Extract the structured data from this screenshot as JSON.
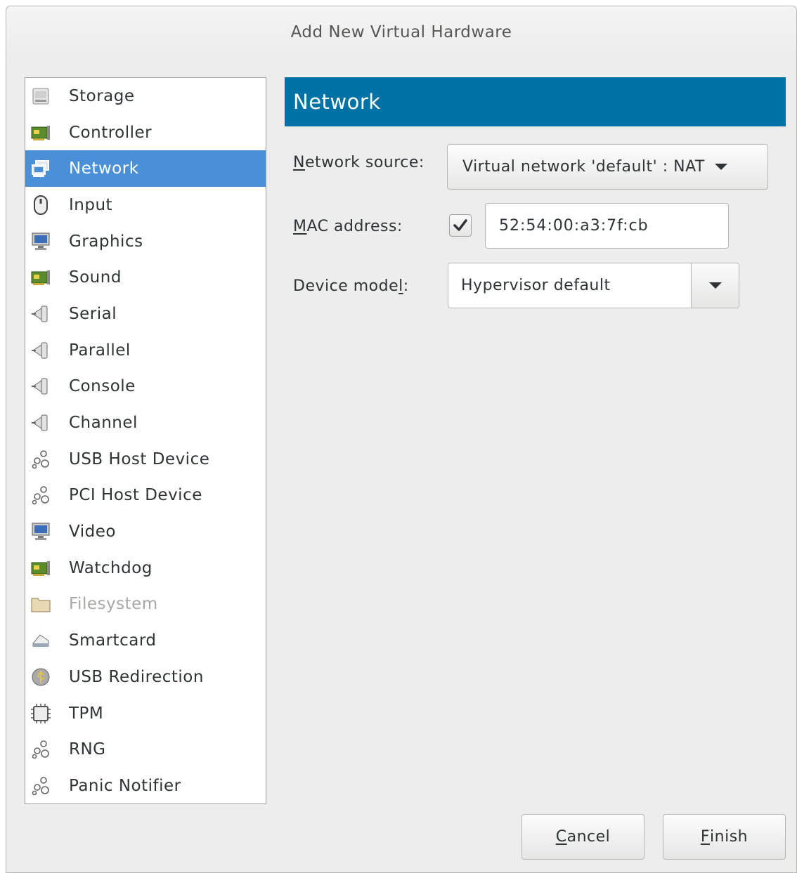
{
  "window": {
    "title": "Add New Virtual Hardware"
  },
  "hardware_list": {
    "selected": "Network",
    "items": [
      {
        "label": "Storage",
        "icon": "storage-icon",
        "enabled": true
      },
      {
        "label": "Controller",
        "icon": "controller-card-icon",
        "enabled": true
      },
      {
        "label": "Network",
        "icon": "network-icon",
        "enabled": true
      },
      {
        "label": "Input",
        "icon": "mouse-icon",
        "enabled": true
      },
      {
        "label": "Graphics",
        "icon": "monitor-icon",
        "enabled": true
      },
      {
        "label": "Sound",
        "icon": "sound-card-icon",
        "enabled": true
      },
      {
        "label": "Serial",
        "icon": "serial-port-icon",
        "enabled": true
      },
      {
        "label": "Parallel",
        "icon": "parallel-port-icon",
        "enabled": true
      },
      {
        "label": "Console",
        "icon": "console-port-icon",
        "enabled": true
      },
      {
        "label": "Channel",
        "icon": "channel-port-icon",
        "enabled": true
      },
      {
        "label": "USB Host Device",
        "icon": "usb-host-device-icon",
        "enabled": true
      },
      {
        "label": "PCI Host Device",
        "icon": "pci-host-device-icon",
        "enabled": true
      },
      {
        "label": "Video",
        "icon": "video-icon",
        "enabled": true
      },
      {
        "label": "Watchdog",
        "icon": "watchdog-card-icon",
        "enabled": true
      },
      {
        "label": "Filesystem",
        "icon": "folder-icon",
        "enabled": false
      },
      {
        "label": "Smartcard",
        "icon": "smartcard-reader-icon",
        "enabled": true
      },
      {
        "label": "USB Redirection",
        "icon": "usb-redirection-icon",
        "enabled": true
      },
      {
        "label": "TPM",
        "icon": "chip-icon",
        "enabled": true
      },
      {
        "label": "RNG",
        "icon": "rng-device-icon",
        "enabled": true
      },
      {
        "label": "Panic Notifier",
        "icon": "panic-notifier-icon",
        "enabled": true
      }
    ]
  },
  "panel": {
    "header": "Network",
    "network_source": {
      "label_mnemonic": "N",
      "label_rest": "etwork source:",
      "value": "Virtual network 'default' : NAT"
    },
    "mac_address": {
      "label_mnemonic": "M",
      "label_rest": "AC address:",
      "checked": true,
      "value": "52:54:00:a3:7f:cb"
    },
    "device_model": {
      "label_before": "Device mode",
      "label_mnemonic": "l",
      "label_after": ":",
      "value": "Hypervisor default"
    }
  },
  "buttons": {
    "cancel": {
      "mnemonic": "C",
      "rest": "ancel"
    },
    "finish": {
      "mnemonic": "F",
      "rest": "inish"
    }
  },
  "colors": {
    "selection": "#4a90d9",
    "header": "#0072a6"
  }
}
